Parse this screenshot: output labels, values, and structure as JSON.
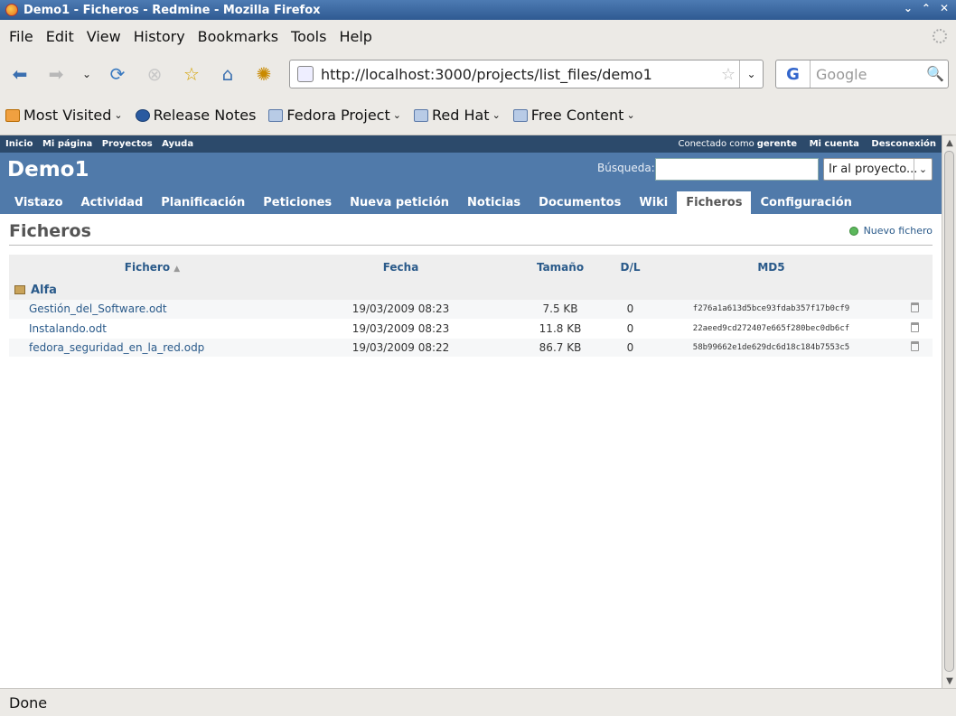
{
  "window": {
    "title": "Demo1 - Ficheros - Redmine - Mozilla Firefox"
  },
  "menu": [
    "File",
    "Edit",
    "View",
    "History",
    "Bookmarks",
    "Tools",
    "Help"
  ],
  "url": "http://localhost:3000/projects/list_files/demo1",
  "search_placeholder": "Google",
  "bookmarks": [
    "Most Visited",
    "Release Notes",
    "Fedora Project",
    "Red Hat",
    "Free Content"
  ],
  "redmine": {
    "topmenu": [
      "Inicio",
      "Mi página",
      "Proyectos",
      "Ayuda"
    ],
    "logged_as_prefix": "Conectado como",
    "user": "gerente",
    "account": "Mi cuenta",
    "logout": "Desconexión",
    "project": "Demo1",
    "search_label": "Búsqueda:",
    "jump": "Ir al proyecto...",
    "tabs": [
      "Vistazo",
      "Actividad",
      "Planificación",
      "Peticiones",
      "Nueva petición",
      "Noticias",
      "Documentos",
      "Wiki",
      "Ficheros",
      "Configuración"
    ],
    "active_tab": "Ficheros",
    "page_title": "Ficheros",
    "new_file": "Nuevo fichero",
    "columns": [
      "Fichero",
      "Fecha",
      "Tamaño",
      "D/L",
      "MD5"
    ],
    "version": "Alfa",
    "files": [
      {
        "name": "Gestión_del_Software.odt",
        "date": "19/03/2009 08:23",
        "size": "7.5 KB",
        "dl": "0",
        "md5": "f276a1a613d5bce93fdab357f17b0cf9"
      },
      {
        "name": "Instalando.odt",
        "date": "19/03/2009 08:23",
        "size": "11.8 KB",
        "dl": "0",
        "md5": "22aeed9cd272407e665f280bec0db6cf"
      },
      {
        "name": "fedora_seguridad_en_la_red.odp",
        "date": "19/03/2009 08:22",
        "size": "86.7 KB",
        "dl": "0",
        "md5": "58b99662e1de629dc6d18c184b7553c5"
      }
    ]
  },
  "status": "Done",
  "colors": {
    "header": "#507aaa",
    "topmenu": "#2c4a6b",
    "link": "#2a5a8a"
  }
}
